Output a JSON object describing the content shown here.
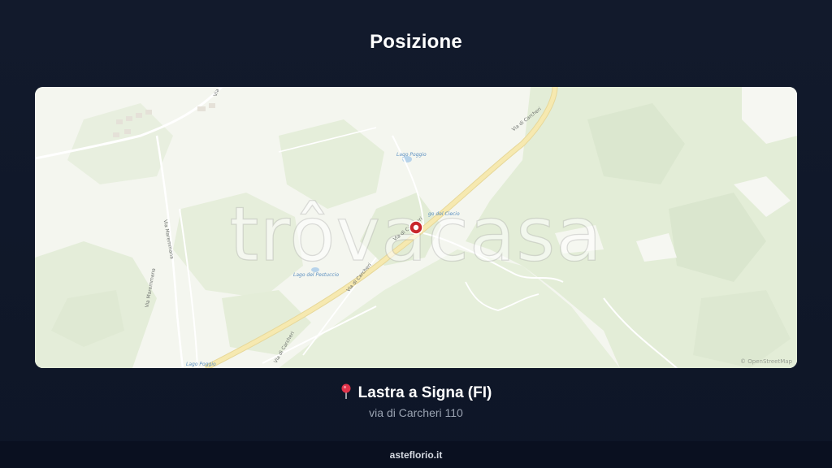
{
  "page": {
    "title": "Posizione"
  },
  "map": {
    "watermark": "trôvacasa",
    "attribution": "© OpenStreetMap",
    "labels": {
      "via_maremmana_1": "Via Maremmana",
      "via_maremmana_2": "Via Maremmana",
      "via_top": "Via",
      "lago_poggio": "Lago Poggio",
      "lago_pestuccio": "Lago del Pestuccio",
      "via_di_carcheri_1": "Via di Carcheri",
      "via_di_carcheri_2": "Via di Carcheri",
      "via_di_carcheri_3": "Via di Carcheri",
      "via_di_carcheri_4": "Via di Carcheri",
      "lago_ciecio": "go del Ciecio",
      "lago_bottom": "Lago Poggio"
    },
    "marker_icon": "location-marker-icon"
  },
  "location": {
    "pin_icon": "map-pin-icon",
    "city": "Lastra a Signa (FI)",
    "address": "via di Carcheri 110"
  },
  "footer": {
    "site": "asteflorio.it"
  }
}
